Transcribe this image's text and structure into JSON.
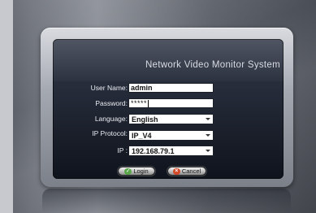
{
  "title": "Network Video Monitor System",
  "form": {
    "username": {
      "label": "User Name:",
      "value": "admin"
    },
    "password": {
      "label": "Password:",
      "value": "*****"
    },
    "language": {
      "label": "Language:",
      "value": "English"
    },
    "ip_protocol": {
      "label": "IP Protocol:",
      "value": "IP_V4"
    },
    "ip": {
      "label": "IP :",
      "value": "192.168.79.1"
    }
  },
  "buttons": {
    "login": "Login",
    "cancel": "Cancel"
  }
}
